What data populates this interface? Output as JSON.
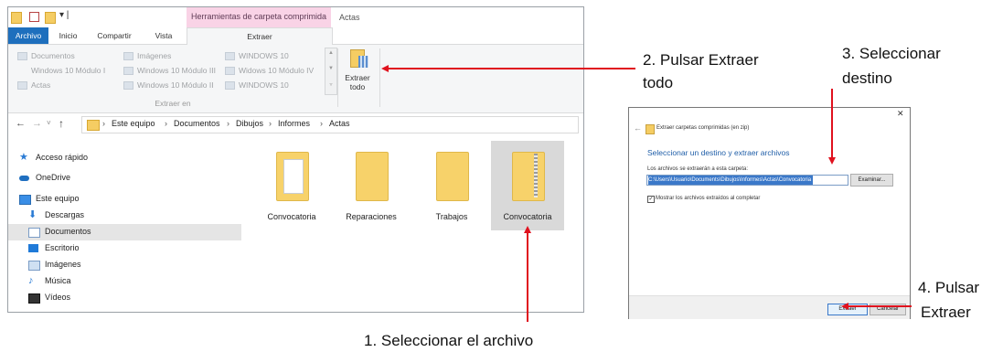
{
  "explorer": {
    "ribbon_context_tab": "Herramientas de carpeta comprimida",
    "window_title": "Actas",
    "tabs": [
      "Archivo",
      "Inicio",
      "Compartir",
      "Vista",
      "Extraer"
    ],
    "extract_locations": [
      [
        "Documentos",
        "Imágenes",
        "WINDOWS 10"
      ],
      [
        "Windows 10 Módulo I",
        "Windows 10 Módulo III",
        "Widows 10 Módulo IV"
      ],
      [
        "Actas",
        "Windows 10 Módulo II",
        "WINDOWS 10"
      ]
    ],
    "group_label": "Extraer en",
    "extract_all_label_1": "Extraer",
    "extract_all_label_2": "todo",
    "breadcrumb": [
      "Este equipo",
      "Documentos",
      "Dibujos",
      "Informes",
      "Actas"
    ],
    "nav_items": [
      "Acceso rápido",
      "OneDrive",
      "Este equipo",
      "Descargas",
      "Documentos",
      "Escritorio",
      "Imágenes",
      "Música",
      "Vídeos"
    ],
    "files": [
      "Convocatoria",
      "Reparaciones",
      "Trabajos",
      "Convocatoria"
    ]
  },
  "dialog": {
    "title": "Extraer carpetas comprimidas (en zip)",
    "heading": "Seleccionar un destino y extraer archivos",
    "label": "Los archivos se extraerán a esta carpeta:",
    "path": "C:\\Users\\Usuario\\Documents\\Dibujos\\Informes\\Actas\\Convocatoria",
    "browse_label": "Examinar...",
    "checkbox_label": "Mostrar los archivos extraídos al completar",
    "checkbox_checked": true,
    "extract_button": "Extraer",
    "cancel_button": "Cancelar",
    "close_glyph": "✕",
    "back_glyph": "←"
  },
  "annotations": {
    "step1": "1.   Seleccionar el archivo",
    "step2_line1": "2. Pulsar Extraer",
    "step2_line2": "todo",
    "step3_line1": "3. Seleccionar",
    "step3_line2": "destino",
    "step4_line1": "4. Pulsar",
    "step4_line2": "Extraer",
    "arrow_color": "#e0111e"
  }
}
